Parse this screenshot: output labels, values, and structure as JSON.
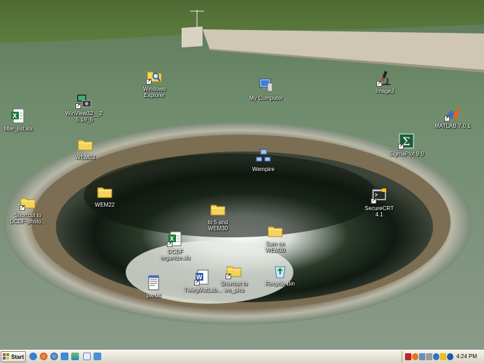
{
  "desktop_icons": [
    {
      "name": "windows-explorer-shortcut",
      "label": "Windows\nExplorer",
      "kind": "folder-magnify",
      "shortcut": true
    },
    {
      "name": "winview32-shortcut",
      "label": "WinView32__2\n.5.19_5",
      "kind": "app-camera",
      "shortcut": true
    },
    {
      "name": "filter-list-xls",
      "label": "filter_list.xls",
      "kind": "excel",
      "shortcut": false
    },
    {
      "name": "wem03-folder",
      "label": "WEM03",
      "kind": "folder",
      "shortcut": false
    },
    {
      "name": "wem22-folder",
      "label": "WEM22",
      "kind": "folder",
      "shortcut": false
    },
    {
      "name": "shortcut-dcdf-photo",
      "label": "Shortcut to\nDCDF-photo...",
      "kind": "folder",
      "shortcut": true
    },
    {
      "name": "my-computer",
      "label": "My Computer",
      "kind": "computer",
      "shortcut": false
    },
    {
      "name": "imagej-shortcut",
      "label": "ImageJ",
      "kind": "microscope",
      "shortcut": true
    },
    {
      "name": "matlab-shortcut",
      "label": "MATLAB 7.0.1",
      "kind": "matlab",
      "shortcut": true
    },
    {
      "name": "sigmaplot-shortcut",
      "label": "SigmaPlot 9.0",
      "kind": "sigmaplot",
      "shortcut": true
    },
    {
      "name": "wempire-network",
      "label": "Wempire",
      "kind": "network",
      "shortcut": false
    },
    {
      "name": "securecrt-shortcut",
      "label": "SecureCRT\n4.1",
      "kind": "terminal",
      "shortcut": true
    },
    {
      "name": "to5-wem30-folder",
      "label": "to 5 and\nWEM30",
      "kind": "folder",
      "shortcut": false
    },
    {
      "name": "sam-wem30-folder",
      "label": "Sam on\nWEM30",
      "kind": "folder",
      "shortcut": false
    },
    {
      "name": "dcdf-organize-xls",
      "label": "DCDF\norganize.xls",
      "kind": "excel",
      "shortcut": true
    },
    {
      "name": "pw-txt",
      "label": "pw.txt",
      "kind": "text",
      "shortcut": false
    },
    {
      "name": "twiegmat-doc",
      "label": "TwiegMatLab...",
      "kind": "word",
      "shortcut": true
    },
    {
      "name": "shortcut-wo-pics",
      "label": "Shortcut to\nwo_pics",
      "kind": "folder",
      "shortcut": true
    },
    {
      "name": "recycle-bin",
      "label": "Recycle Bin",
      "kind": "recycle",
      "shortcut": false
    }
  ],
  "taskbar": {
    "start_label": "Start",
    "clock": "4:24 PM",
    "quick_launch": [
      "ie-icon",
      "firefox-icon",
      "thunderbird-icon",
      "winamp-icon",
      "photo-icon",
      "notepad-icon",
      "pidgin-icon"
    ],
    "tray_icons": [
      "red-tray-icon",
      "orange-tray-icon",
      "monitor-tray-icon",
      "volume-icon",
      "security-icon",
      "antivirus-icon",
      "info-icon"
    ]
  },
  "colors": {
    "folder": "#f3d35a",
    "excel": "#1d7a3a",
    "word": "#2b57a8",
    "taskbar": "#e8e5d8"
  }
}
